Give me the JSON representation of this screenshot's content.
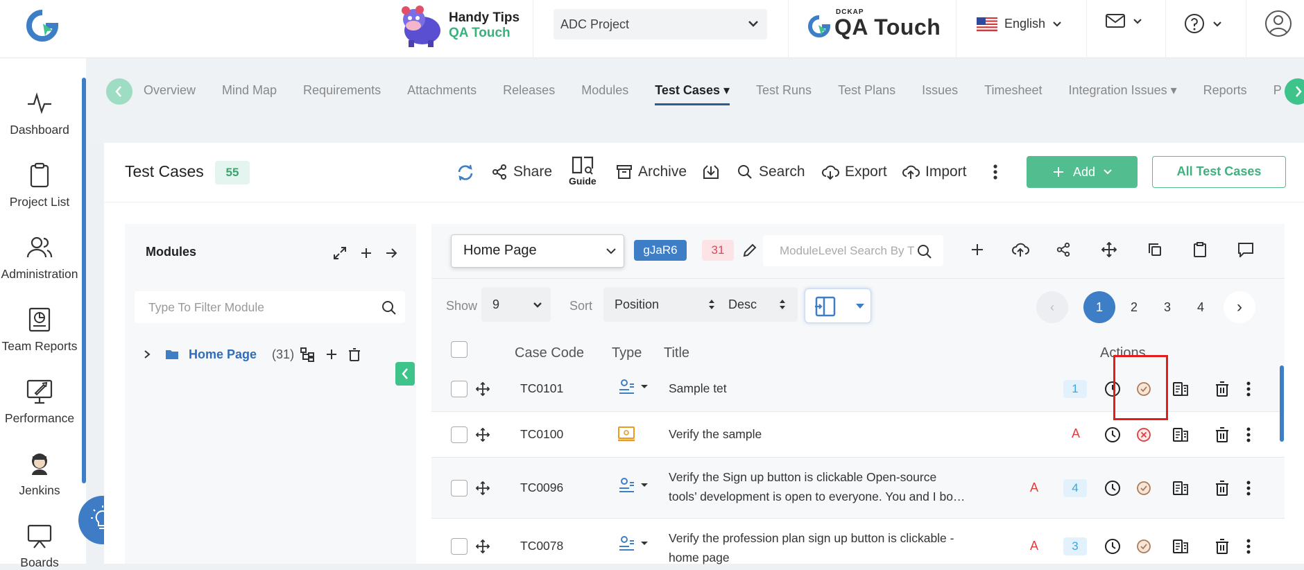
{
  "header": {
    "handy_line1": "Handy Tips",
    "handy_line2": "QA Touch",
    "project": "ADC Project",
    "brand_small": "DCKAP",
    "brand_name": "QA Touch",
    "language": "English"
  },
  "sidebar": {
    "items": [
      {
        "label": "Dashboard",
        "icon": "activity-icon"
      },
      {
        "label": "Project List",
        "icon": "clipboard-icon"
      },
      {
        "label": "Administration",
        "icon": "users-icon"
      },
      {
        "label": "Team Reports",
        "icon": "report-icon"
      },
      {
        "label": "Performance",
        "icon": "rocket-icon"
      },
      {
        "label": "Jenkins",
        "icon": "jenkins-icon"
      },
      {
        "label": "Boards",
        "icon": "board-icon"
      }
    ]
  },
  "tabs": [
    {
      "label": "Overview"
    },
    {
      "label": "Mind Map"
    },
    {
      "label": "Requirements"
    },
    {
      "label": "Attachments"
    },
    {
      "label": "Releases"
    },
    {
      "label": "Modules"
    },
    {
      "label": "Test Cases",
      "active": true
    },
    {
      "label": "Test Runs"
    },
    {
      "label": "Test Plans"
    },
    {
      "label": "Issues"
    },
    {
      "label": "Timesheet"
    },
    {
      "label": "Integration Issues"
    },
    {
      "label": "Reports"
    },
    {
      "label": "P"
    }
  ],
  "page": {
    "title": "Test Cases",
    "count": "55",
    "share": "Share",
    "guide": "Guide",
    "archive": "Archive",
    "search": "Search",
    "export": "Export",
    "import": "Import",
    "add": "Add",
    "all_test_cases": "All Test Cases"
  },
  "modules": {
    "title": "Modules",
    "filter_placeholder": "Type To Filter Module",
    "tree_item": "Home Page",
    "tree_count": "(31)"
  },
  "testcases": {
    "module": "Home Page",
    "code_tag": "gJaR6",
    "count_tag": "31",
    "search_placeholder": "ModuleLevel Search By T",
    "show_label": "Show",
    "show_value": "9",
    "sort_label": "Sort",
    "sort_value": "Position",
    "order_value": "Desc",
    "pages": [
      "1",
      "2",
      "3",
      "4"
    ],
    "prev": "‹",
    "next": "›",
    "columns": {
      "code": "Case Code",
      "type": "Type",
      "title": "Title",
      "actions": "Actions"
    },
    "rows": [
      {
        "code": "TC0101",
        "title": "Sample tet",
        "title2": "",
        "ra": "",
        "badge": "1",
        "status": "check"
      },
      {
        "code": "TC0100",
        "title": "Verify the sample",
        "title2": "",
        "ra": "A",
        "badge": "",
        "status": "cross"
      },
      {
        "code": "TC0096",
        "title": "Verify the Sign up button is clickable Open-source",
        "title2": "tools’ development is open to everyone. You and I bo…",
        "ra": "A",
        "badge": "4",
        "status": "check"
      },
      {
        "code": "TC0078",
        "title": "Verify the profession plan sign up button is clickable -",
        "title2": "home page",
        "ra": "A",
        "badge": "3",
        "status": "check"
      }
    ]
  },
  "colors": {
    "accent_green": "#52bd8f",
    "accent_blue": "#3d7ec7",
    "highlight_red": "#e51c1c"
  }
}
